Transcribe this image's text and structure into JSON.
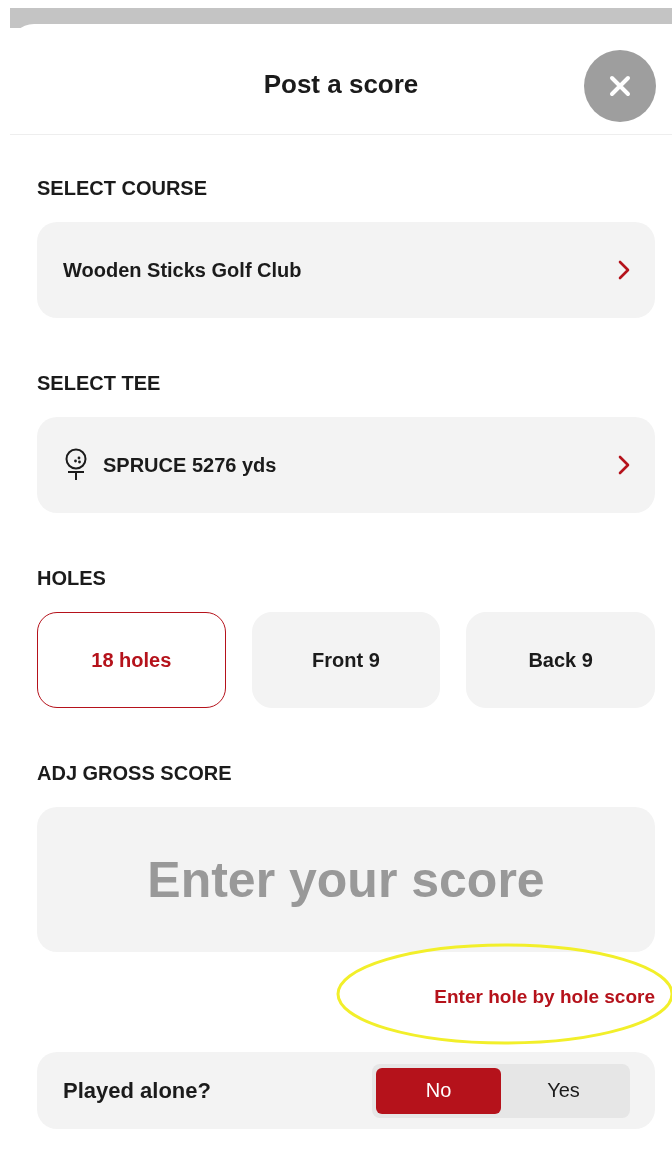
{
  "header": {
    "title": "Post a score"
  },
  "course": {
    "label": "SELECT COURSE",
    "value": "Wooden Sticks Golf Club"
  },
  "tee": {
    "label": "SELECT TEE",
    "value": "SPRUCE 5276 yds"
  },
  "holes": {
    "label": "HOLES",
    "options": [
      {
        "label": "18 holes",
        "selected": true
      },
      {
        "label": "Front 9",
        "selected": false
      },
      {
        "label": "Back 9",
        "selected": false
      }
    ]
  },
  "score": {
    "label": "ADJ GROSS SCORE",
    "placeholder": "Enter your score",
    "link": "Enter hole by hole score"
  },
  "played_alone": {
    "label": "Played alone?",
    "options": [
      {
        "label": "No",
        "selected": true
      },
      {
        "label": "Yes",
        "selected": false
      }
    ]
  }
}
